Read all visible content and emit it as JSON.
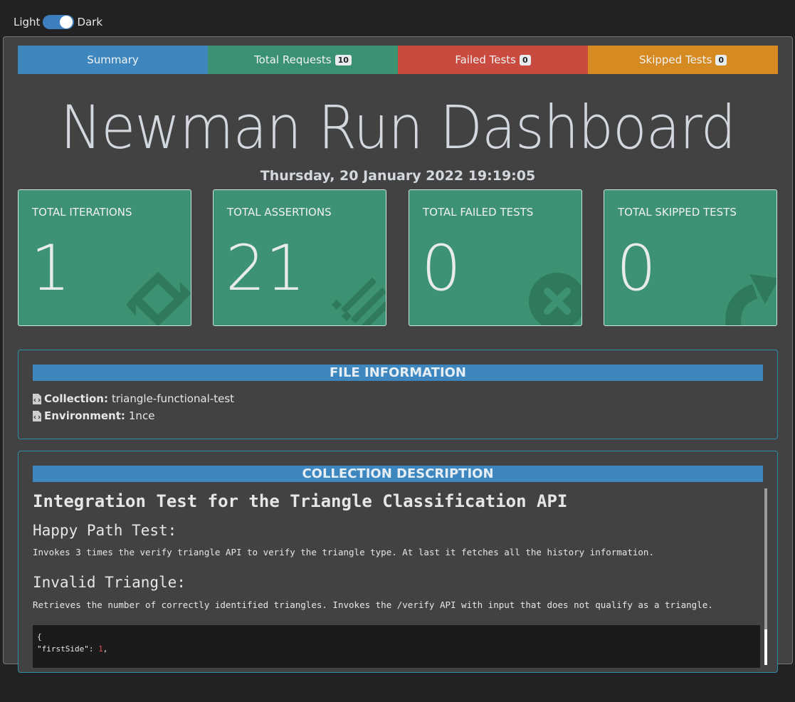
{
  "theme": {
    "light_label": "Light",
    "dark_label": "Dark"
  },
  "tabs": [
    {
      "label": "Summary",
      "badge": ""
    },
    {
      "label": "Total Requests",
      "badge": "10"
    },
    {
      "label": "Failed Tests",
      "badge": "0"
    },
    {
      "label": "Skipped Tests",
      "badge": "0"
    }
  ],
  "title": "Newman Run Dashboard",
  "run_date": "Thursday, 20 January 2022 19:19:05",
  "cards": [
    {
      "label": "Total Iterations",
      "value": "1",
      "icon": "sync-icon"
    },
    {
      "label": "Total Assertions",
      "value": "21",
      "icon": "list-icon"
    },
    {
      "label": "Total Failed Tests",
      "value": "0",
      "icon": "times-circle-icon"
    },
    {
      "label": "Total Skipped Tests",
      "value": "0",
      "icon": "share-arrow-icon"
    }
  ],
  "file_info": {
    "heading": "FILE INFORMATION",
    "collection_label": "Collection:",
    "collection_value": "triangle-functional-test",
    "environment_label": "Environment:",
    "environment_value": "1nce"
  },
  "collection_description": {
    "heading": "COLLECTION DESCRIPTION",
    "h1": "Integration Test for the Triangle Classification API",
    "section1_title": "Happy Path Test:",
    "section1_text": "Invokes 3 times the verify triangle API to verify the triangle type. At last it fetches all the history information.",
    "section2_title": "Invalid Triangle:",
    "section2_text": "Retrieves the number of correctly identified triangles. Invokes the /verify API with input that does not qualify as a triangle.",
    "code_line1": "{",
    "code_key": "\"firstSide\": ",
    "code_num": "1",
    "code_comma": ","
  },
  "colors": {
    "summary": "#3e87be",
    "total": "#3a9272",
    "failed": "#c94a3e",
    "skipped": "#d68a22",
    "card": "#3d9273"
  }
}
